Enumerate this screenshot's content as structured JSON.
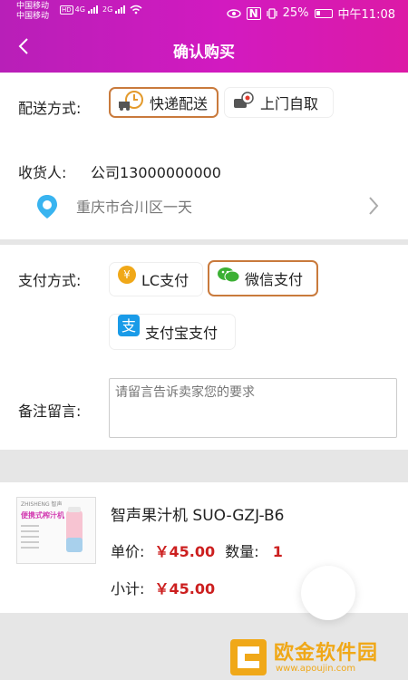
{
  "status": {
    "carrier1": "中国移动",
    "carrier2": "中国移动",
    "hd": "HD",
    "net1": "4G",
    "net2": "2G",
    "nfc": "N",
    "battery_pct": "25%",
    "time": "中午11:08"
  },
  "nav": {
    "back_icon": "chevron-left-icon",
    "title": "确认购买"
  },
  "delivery": {
    "label": "配送方式:",
    "options": [
      {
        "label": "快递配送",
        "icon": "delivery-truck-icon",
        "selected": true
      },
      {
        "label": "上门自取",
        "icon": "pickup-pin-icon",
        "selected": false
      }
    ]
  },
  "receiver": {
    "label": "收货人:",
    "value": "公司13000000000",
    "address": "重庆市合川区一天"
  },
  "payment": {
    "label": "支付方式:",
    "options": [
      {
        "label": "LC支付",
        "icon": "coin-icon",
        "selected": false
      },
      {
        "label": "微信支付",
        "icon": "wechat-icon",
        "selected": true
      },
      {
        "label": "支付宝支付",
        "icon": "alipay-icon",
        "selected": false
      }
    ]
  },
  "note": {
    "label": "备注留言:",
    "placeholder": "请留言告诉卖家您的要求"
  },
  "product": {
    "name": "智声果汁机 SUO-GZJ-B6",
    "img_brand": "ZHISHENG 智声",
    "img_caption": "便携式榨汁机",
    "unit_price_label": "单价:",
    "unit_price": "￥45.00",
    "qty_label": "数量:",
    "qty": "1",
    "subtotal_label": "小计:",
    "subtotal": "￥45.00"
  },
  "watermark": {
    "title": "欧金软件园",
    "url": "www.apoujin.com"
  },
  "colors": {
    "header_start": "#b81fb8",
    "header_end": "#dc1aa6",
    "selected_border": "#c97a3c",
    "price_red": "#cc1f1f"
  }
}
